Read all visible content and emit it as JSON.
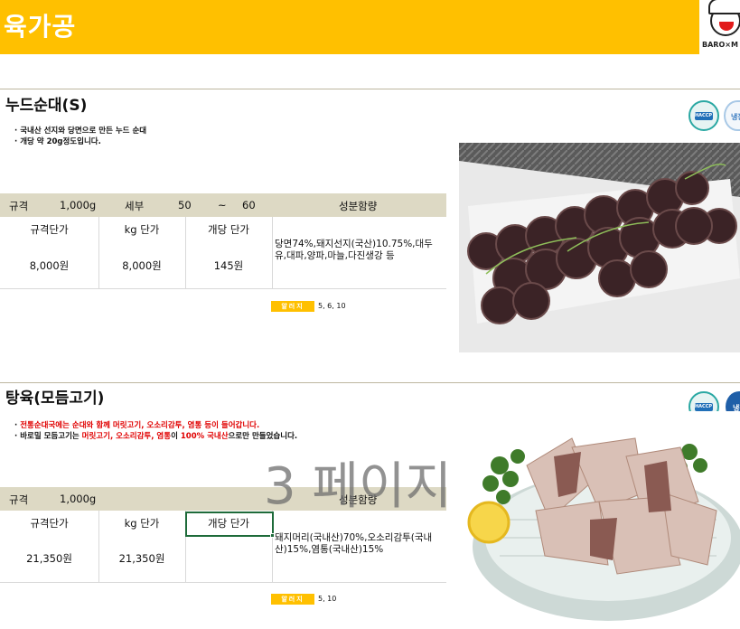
{
  "header": {
    "title": "육가공",
    "logo_text": "BARO×M"
  },
  "products": [
    {
      "name": "누드순대(S)",
      "badges": [
        "HACCP",
        "냉장"
      ],
      "description": [
        "· 국내산 선지와 당면으로 만든 누드 순대",
        "· 개당 약 20g정도입니다."
      ],
      "spec": {
        "label": "규격",
        "value": "1,000g",
        "sub_label": "세부",
        "range_from": "50",
        "range_sep": "~",
        "range_to": "60",
        "ingredients_header": "성분함량"
      },
      "price_headers": [
        "규격단가",
        "kg 단가",
        "개당 단가"
      ],
      "prices": [
        "8,000원",
        "8,000원",
        "145원"
      ],
      "ingredients": "당면74%,돼지선지(국산)10.75%,대두유,대파,양파,마늘,다진생강 등",
      "allergy_label": "알러지",
      "allergy": "5, 6, 10"
    },
    {
      "name": "탕육(모듬고기)",
      "badges": [
        "HACCP",
        "냉장"
      ],
      "description": [
        {
          "parts": [
            {
              "text": "· ",
              "red": false
            },
            {
              "text": "전통순대국에는 순대와 함께 머릿고기, 오소리감투, 염통 등이 들어갑니다.",
              "red": true
            }
          ]
        },
        {
          "parts": [
            {
              "text": "· 바로밀 모듬고기는 ",
              "red": false
            },
            {
              "text": "머릿고기, 오소리감투, 염통",
              "red": true
            },
            {
              "text": "이 ",
              "red": false
            },
            {
              "text": "100% 국내산",
              "red": true
            },
            {
              "text": "으로만 만들었습니다.",
              "red": false
            }
          ]
        }
      ],
      "spec": {
        "label": "규격",
        "value": "1,000g",
        "ingredients_header": "성분함량"
      },
      "price_headers": [
        "규격단가",
        "kg 단가",
        "개당 단가"
      ],
      "prices": [
        "21,350원",
        "21,350원",
        ""
      ],
      "ingredients": "돼지머리(국내산)70%,오소리감투(국내산)15%,염통(국내산)15%",
      "allergy_label": "알러지",
      "allergy": "5, 10"
    }
  ],
  "watermark": "3 페이지",
  "colors": {
    "header": "#ffc000",
    "spec_bar": "#ddd9c4",
    "highlight_red": "#e00000",
    "selection": "#1e6b3a"
  }
}
